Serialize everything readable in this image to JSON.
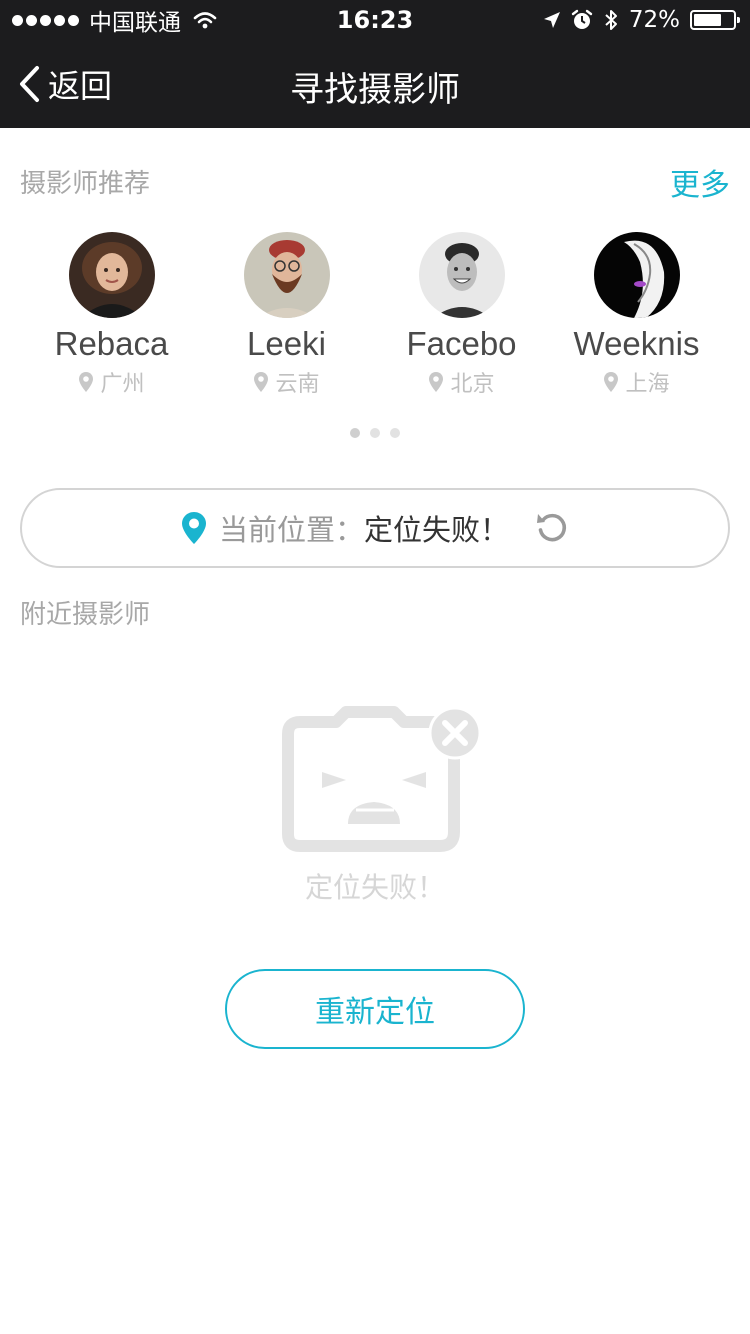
{
  "status_bar": {
    "carrier": "中国联通",
    "time": "16:23",
    "battery": "72%",
    "battery_level": 0.72
  },
  "nav": {
    "back_label": "返回",
    "title": "寻找摄影师"
  },
  "recommend": {
    "title": "摄影师推荐",
    "more_label": "更多",
    "photographers": [
      {
        "name": "Rebaca",
        "city": "广州"
      },
      {
        "name": "Leeki",
        "city": "云南"
      },
      {
        "name": "Facebo",
        "city": "北京"
      },
      {
        "name": "Weeknis",
        "city": "上海"
      }
    ],
    "pages": 3,
    "active_page": 1
  },
  "location": {
    "label": "当前位置：",
    "status": "定位失败！"
  },
  "nearby": {
    "title": "附近摄影师",
    "empty_text": "定位失败！",
    "relocate_label": "重新定位"
  },
  "colors": {
    "accent": "#1ab4cf",
    "header_bg": "#1c1c1e",
    "muted_text": "#a8a8a8"
  },
  "icons": {
    "back": "chevron-left-icon",
    "pin": "map-pin-icon",
    "refresh": "refresh-icon",
    "empty": "broken-camera-icon"
  }
}
